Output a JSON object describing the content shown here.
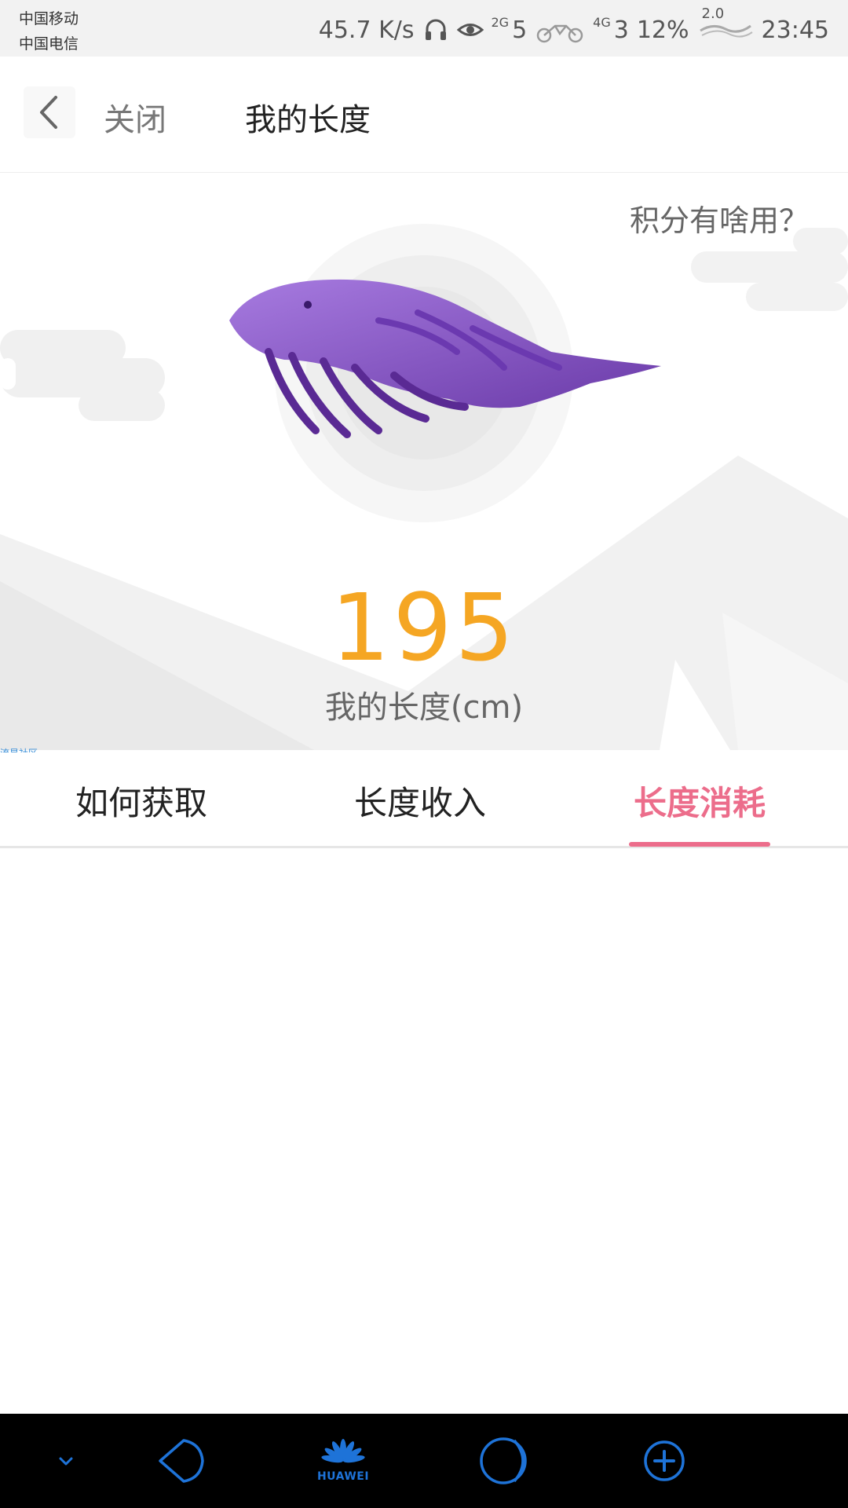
{
  "status_bar": {
    "carrier_1": "中国移动",
    "carrier_2": "中国电信",
    "net_speed": "45.7 K/s",
    "signal_1_type": "2G",
    "signal_1_num": "5",
    "signal_2_type": "4G",
    "signal_2_num": "3",
    "battery": "12%",
    "battery_overlay": "2.0",
    "time": "23:45",
    "icons": [
      "headphones-icon",
      "eye-icon",
      "signal-icon",
      "motorcycle-icon",
      "signal-icon",
      "battery-decor-icon"
    ]
  },
  "header": {
    "back_icon": "chevron-left-icon",
    "close_label": "关闭",
    "title": "我的长度"
  },
  "hero": {
    "help_link": "积分有啥用？",
    "value": "195",
    "label": "我的长度(cm)",
    "watermark": "流星社区",
    "value_color": "#f5a623"
  },
  "tabs": {
    "items": [
      {
        "label": "如何获取",
        "active": false
      },
      {
        "label": "长度收入",
        "active": false
      },
      {
        "label": "长度消耗",
        "active": true
      }
    ],
    "active_color": "#ec6d8b"
  },
  "nav_bar": {
    "items": [
      "chevron-down-icon",
      "back-triangle-icon",
      "huawei-logo-icon",
      "home-circle-icon",
      "plus-circle-icon"
    ],
    "logo_text": "HUAWEI",
    "accent": "#1e73d8"
  }
}
